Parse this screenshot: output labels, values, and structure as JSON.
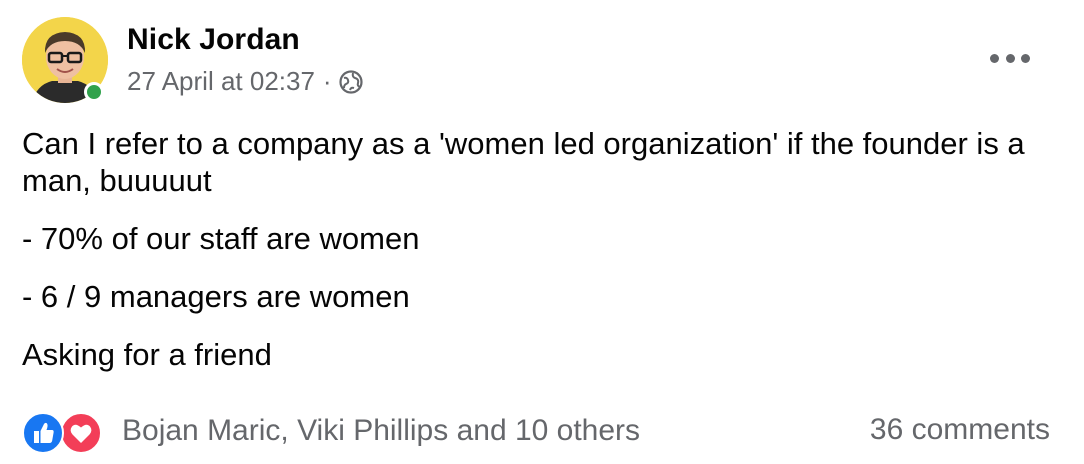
{
  "post": {
    "author": "Nick Jordan",
    "timestamp": "27 April at 02:37",
    "separator": "·",
    "privacy_icon": "globe-icon",
    "options_icon": "more-horizontal-icon",
    "online_status_color": "#31a24c",
    "body": [
      "Can I refer to a company as a 'women led organization' if the founder is a man, buuuuut",
      "- 70% of our staff are women",
      "- 6 / 9 managers are women",
      "Asking for a friend"
    ],
    "reactions": {
      "icons": [
        "like-icon",
        "love-icon"
      ],
      "summary": "Bojan Maric, Viki Phillips and 10 others"
    },
    "comments": "36 comments"
  },
  "colors": {
    "text_primary": "#050505",
    "text_secondary": "#65676b",
    "like_blue": "#1877f2",
    "love_red": "#f33e58",
    "avatar_bg": "#f3d54a"
  }
}
